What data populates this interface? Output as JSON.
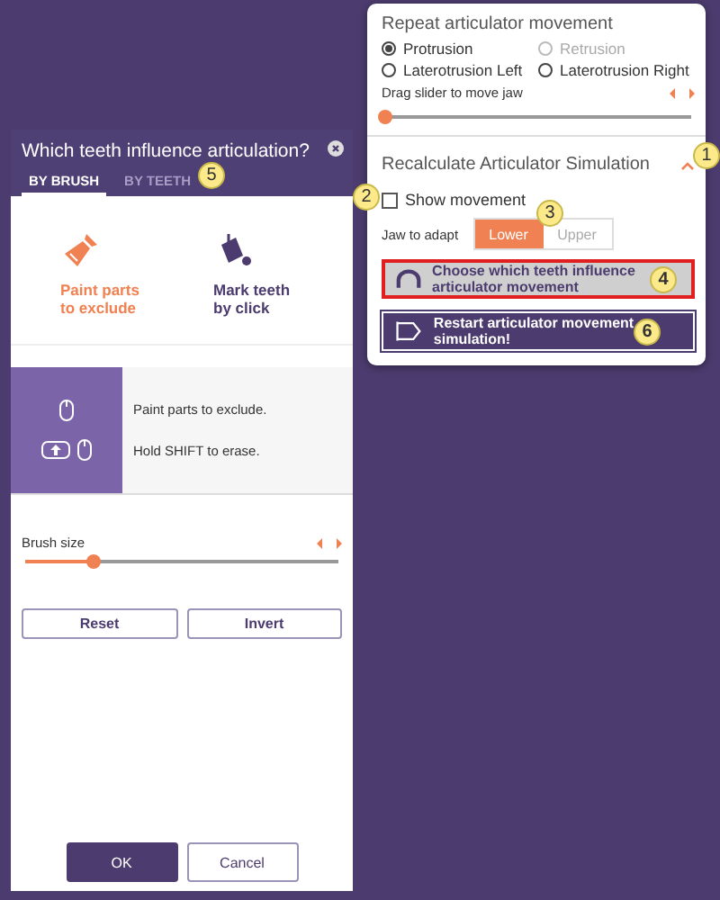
{
  "articulator_panel": {
    "repeat_title": "Repeat articulator movement",
    "movements": [
      {
        "label": "Protrusion",
        "selected": true,
        "disabled": false
      },
      {
        "label": "Retrusion",
        "selected": false,
        "disabled": true
      },
      {
        "label": "Laterotrusion Left",
        "selected": false,
        "disabled": false
      },
      {
        "label": "Laterotrusion Right",
        "selected": false,
        "disabled": false
      }
    ],
    "slider": {
      "label": "Drag slider to move jaw",
      "level": 0.0
    },
    "recalc": {
      "title": "Recalculate Articulator Simulation",
      "expanded": true,
      "callout": "1"
    },
    "show_movement": {
      "label": "Show movement",
      "checked": false,
      "callout": "2"
    },
    "jaw": {
      "label": "Jaw to adapt",
      "callout": "3",
      "options": [
        {
          "label": "Lower",
          "selected": true
        },
        {
          "label": "Upper",
          "selected": false
        }
      ]
    },
    "choose_button": {
      "label": "Choose which teeth influence articulator movement",
      "callout": "4"
    },
    "restart_button": {
      "label": "Restart articulator movement simulation!",
      "callout": "6"
    }
  },
  "dialog": {
    "title": "Which teeth influence articulation?",
    "tabs": [
      {
        "label": "BY BRUSH",
        "selected": true
      },
      {
        "label": "BY TEETH",
        "selected": false
      }
    ],
    "tabs_callout": "5",
    "tools": [
      {
        "kind": "brush",
        "label": "Paint parts to exclude",
        "selected": true
      },
      {
        "kind": "bucket",
        "label": "Mark teeth by click",
        "selected": false
      }
    ],
    "hints": [
      "Paint parts to exclude.",
      "Hold SHIFT to erase."
    ],
    "brush_size": {
      "label": "Brush size",
      "level": 0.22
    },
    "actions": [
      "Reset",
      "Invert"
    ],
    "ok": "OK",
    "cancel": "Cancel"
  }
}
